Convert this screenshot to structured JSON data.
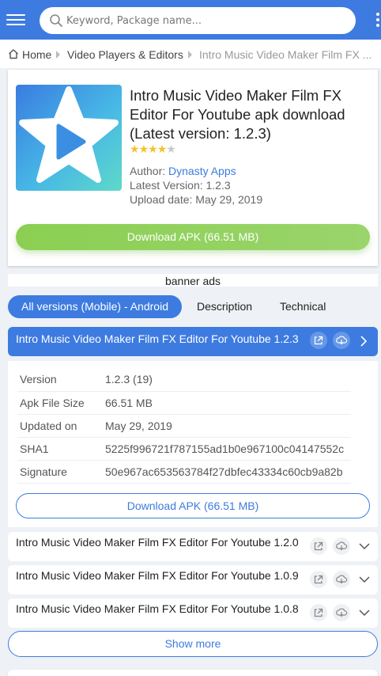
{
  "search": {
    "placeholder": "Keyword, Package name..."
  },
  "breadcrumb": {
    "home": "Home",
    "category": "Video Players & Editors",
    "current": "Intro Music Video Maker Film FX ..."
  },
  "app": {
    "title": "Intro Music Video Maker Film FX Editor For Youtube apk download (Latest version: 1.2.3)",
    "rating_stars": 4,
    "rating_max": 5,
    "author_label": "Author:",
    "author": "Dynasty Apps",
    "latest_version": "Latest Version: 1.2.3",
    "upload_date": "Upload date: May 29, 2019",
    "download_label": "Download APK (66.51 MB)"
  },
  "banner": "banner ads",
  "tabs": [
    {
      "label": "All versions (Mobile) - Android",
      "active": true
    },
    {
      "label": "Description",
      "active": false
    },
    {
      "label": "Technical",
      "active": false
    }
  ],
  "current_version": {
    "title": "Intro Music Video Maker Film FX Editor For Youtube 1.2.3",
    "details": [
      {
        "key": "Version",
        "value": "1.2.3 (19)"
      },
      {
        "key": "Apk File Size",
        "value": "66.51 MB"
      },
      {
        "key": "Updated on",
        "value": "May 29, 2019"
      },
      {
        "key": "SHA1",
        "value": "5225f996721f787155ad1b0e967100c04147552c"
      },
      {
        "key": "Signature",
        "value": "50e967ac653563784f27dbfec43334c60cb9a82b"
      }
    ],
    "download_label": "Download APK (66.51 MB)"
  },
  "other_versions": [
    {
      "title": "Intro Music Video Maker Film FX Editor For Youtube 1.2.0"
    },
    {
      "title": "Intro Music Video Maker Film FX Editor For Youtube 1.0.9"
    },
    {
      "title": "Intro Music Video Maker Film FX Editor For Youtube 1.0.8"
    }
  ],
  "show_more": "Show more",
  "colors": {
    "accent": "#3d7be0",
    "download_green": "#8bcf52",
    "star": "#f2c230"
  }
}
